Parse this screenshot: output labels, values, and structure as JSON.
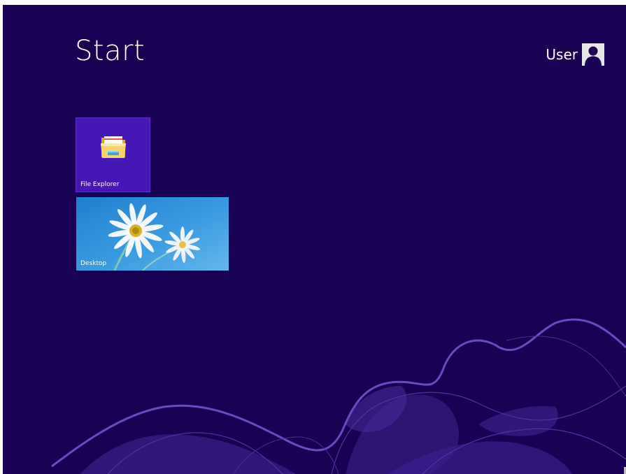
{
  "screen": {
    "title": "Start",
    "user": {
      "name": "User",
      "avatar_icon": "user-avatar-icon"
    }
  },
  "tiles": [
    {
      "label": "File Explorer",
      "icon": "folder-icon",
      "color": "#4617b4"
    },
    {
      "label": "Desktop",
      "icon": "daisy-wallpaper",
      "color": "#2f8fd9"
    }
  ],
  "colors": {
    "background": "#180052",
    "accent_wave": "#6a4cc0"
  }
}
